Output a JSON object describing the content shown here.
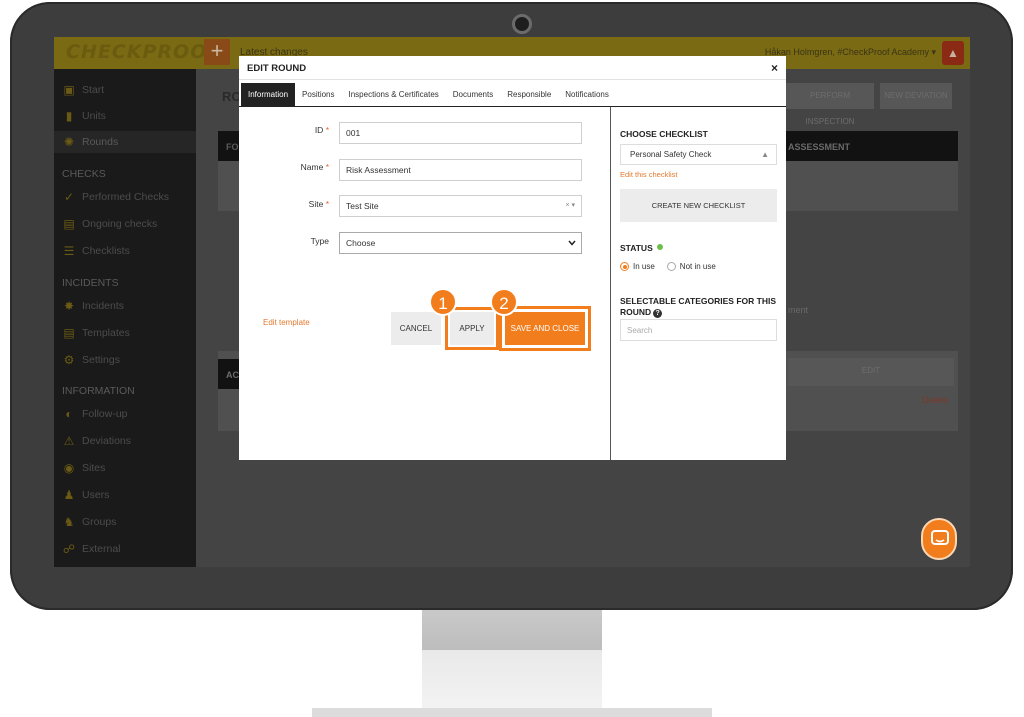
{
  "app": {
    "logo": "CHECKPROOF",
    "latest_changes": "Latest changes",
    "user": "Håkan Holmgren, #CheckProof Academy ▾",
    "partial_round_title": "RO",
    "partial_panel_a": "FO",
    "partial_panel_b": "AC",
    "bg_buttons": {
      "perform_inspection": "PERFORM INSPECTION",
      "new_deviation": "NEW DEVIATION",
      "edit": "EDIT"
    },
    "bg_header_assessment": "ASSESSMENT",
    "bg_text_ment": "ment",
    "bg_text_delete": "Delete"
  },
  "sidebar": {
    "items_top": [
      {
        "label": "Start",
        "icon": "dashboard-icon"
      },
      {
        "label": "Units",
        "icon": "truck-icon"
      },
      {
        "label": "Rounds",
        "icon": "route-icon"
      }
    ],
    "section_checks": "CHECKS",
    "items_checks": [
      {
        "label": "Performed Checks",
        "icon": "check-circle-icon"
      },
      {
        "label": "Ongoing checks",
        "icon": "clipboard-icon"
      },
      {
        "label": "Checklists",
        "icon": "list-icon"
      }
    ],
    "section_incidents": "INCIDENTS",
    "items_incidents": [
      {
        "label": "Incidents",
        "icon": "burst-icon"
      },
      {
        "label": "Templates",
        "icon": "document-icon"
      },
      {
        "label": "Settings",
        "icon": "settings-icon"
      }
    ],
    "section_information": "INFORMATION",
    "items_information": [
      {
        "label": "Follow-up",
        "icon": "chart-icon"
      },
      {
        "label": "Deviations",
        "icon": "alert-icon"
      },
      {
        "label": "Sites",
        "icon": "globe-icon"
      },
      {
        "label": "Users",
        "icon": "user-icon"
      },
      {
        "label": "Groups",
        "icon": "group-icon"
      },
      {
        "label": "External",
        "icon": "handshake-icon"
      }
    ]
  },
  "modal": {
    "title": "EDIT ROUND",
    "close": "×",
    "tabs": [
      "Information",
      "Positions",
      "Inspections & Certificates",
      "Documents",
      "Responsible",
      "Notifications"
    ],
    "form": {
      "id_label": "ID",
      "id_value": "001",
      "name_label": "Name",
      "name_value": "Risk Assessment",
      "site_label": "Site",
      "site_value": "Test Site",
      "site_controls": "× ▾",
      "type_label": "Type",
      "type_value": "Choose",
      "required_mark": "*"
    },
    "edit_template": "Edit template",
    "buttons": {
      "cancel": "CANCEL",
      "apply": "APPLY",
      "save_close": "SAVE AND CLOSE"
    },
    "badges": [
      "1",
      "2"
    ],
    "right": {
      "choose_checklist": "CHOOSE CHECKLIST",
      "checklist_value": "Personal Safety Check",
      "edit_checklist": "Edit this checklist",
      "create_checklist": "CREATE NEW CHECKLIST",
      "status_title": "STATUS",
      "status_in_use": "In use",
      "status_not_in_use": "Not in use",
      "categories_title_1": "SELECTABLE CATEGORIES FOR THIS",
      "categories_title_2": "ROUND",
      "search_placeholder": "Search"
    }
  },
  "colors": {
    "accent": "#f27d1c",
    "status_green": "#6cc04a"
  }
}
